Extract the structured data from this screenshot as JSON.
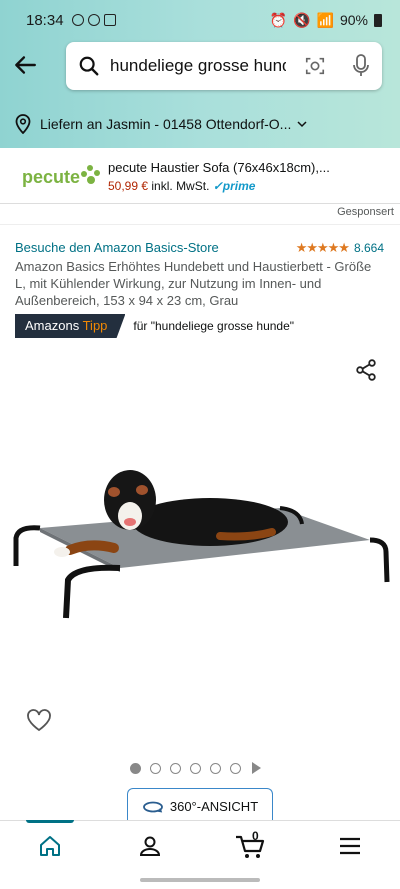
{
  "status": {
    "time": "18:34",
    "battery": "90%"
  },
  "search": {
    "query": "hundeliege grosse hunde"
  },
  "delivery": {
    "text": "Liefern an Jasmin - 01458 Ottendorf-O..."
  },
  "sponsored": {
    "logo_text": "pecute",
    "title": "pecute Haustier Sofa (76x46x18cm),...",
    "price": "50,99 €",
    "price_suffix": "inkl. MwSt.",
    "prime": "✓prime",
    "label": "Gesponsert"
  },
  "product": {
    "store_link": "Besuche den Amazon Basics-Store",
    "stars": "★★★★★",
    "review_count": "8.664",
    "title": "Amazon Basics Erhöhtes Hundebett und Haustierbett - Größe L, mit Kühlender Wirkung, zur Nutzung im Innen- und Außenbereich, 153 x 94 x 23 cm, Grau",
    "badge_prefix": "Amazons",
    "badge_highlight": "Tipp",
    "badge_for": "für \"hundeliege grosse hunde\"",
    "view360_label": "360°-ANSICHT"
  },
  "carousel": {
    "total_dots": 6,
    "active_index": 0
  },
  "navbar": {
    "cart_count": "0"
  },
  "colors": {
    "header_teal": "#8fd3d1",
    "link": "#007185",
    "star": "#de7921",
    "price": "#b12704",
    "badge_bg": "#232f3e",
    "tipp": "#f08804"
  }
}
